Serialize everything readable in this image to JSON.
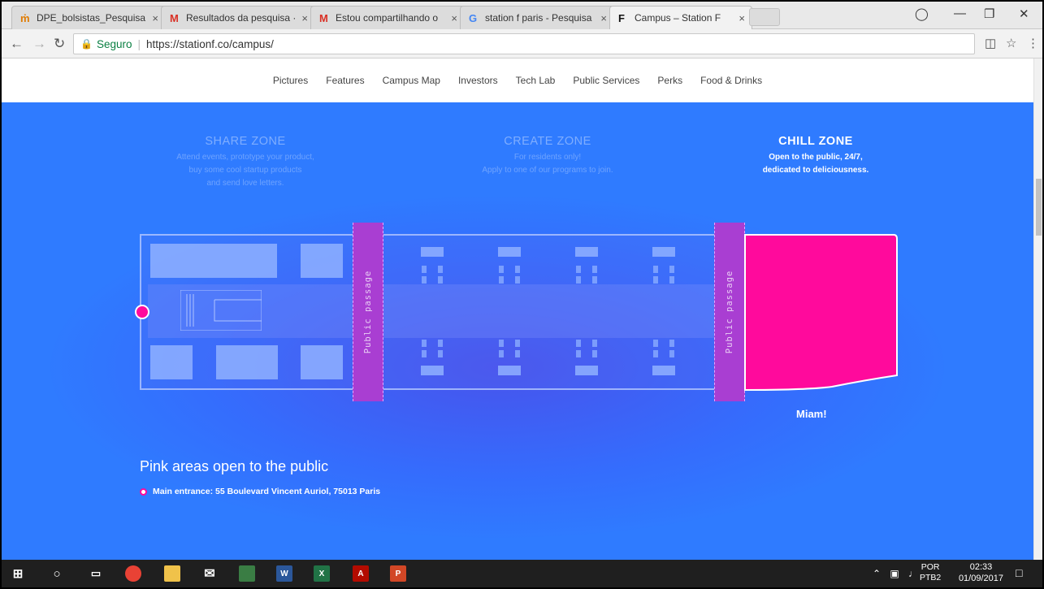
{
  "browser": {
    "tabs": [
      {
        "icon": "ṁ",
        "title": "DPE_bolsistas_Pesquisa",
        "close": "×"
      },
      {
        "icon": "M",
        "title": "Resultados da pesquisa ·",
        "close": "×"
      },
      {
        "icon": "M",
        "title": "Estou compartilhando o",
        "close": "×"
      },
      {
        "icon": "G",
        "title": "station f paris - Pesquisa",
        "close": "×"
      },
      {
        "icon": "F",
        "title": "Campus – Station F",
        "close": "×"
      }
    ],
    "secure_label": "Seguro",
    "url": "https://stationf.co/campus/"
  },
  "site_nav": [
    "Pictures",
    "Features",
    "Campus Map",
    "Investors",
    "Tech Lab",
    "Public Services",
    "Perks",
    "Food & Drinks"
  ],
  "zones": {
    "share": {
      "title": "SHARE ZONE",
      "desc1": "Attend events, prototype your product,",
      "desc2": "buy some cool startup products",
      "desc3": "and send love letters."
    },
    "create": {
      "title": "CREATE ZONE",
      "desc1": "For residents only!",
      "desc2": "Apply to one of our programs to join."
    },
    "chill": {
      "title": "CHILL ZONE",
      "desc1": "Open to the public, 24/7,",
      "desc2": "dedicated to deliciousness."
    }
  },
  "map": {
    "passage_label": "Public passage",
    "chill_label": "Miam!",
    "colors": {
      "public": "#ff0a9c",
      "passage": "#a93ed2",
      "background": "#2f7bff"
    }
  },
  "legend": {
    "title": "Pink areas open to the public",
    "entrance": "Main entrance: 55 Boulevard Vincent Auriol, 75013 Paris"
  },
  "taskbar": {
    "lang1": "POR",
    "lang2": "PTB2",
    "time": "02:33",
    "date": "01/09/2017"
  }
}
